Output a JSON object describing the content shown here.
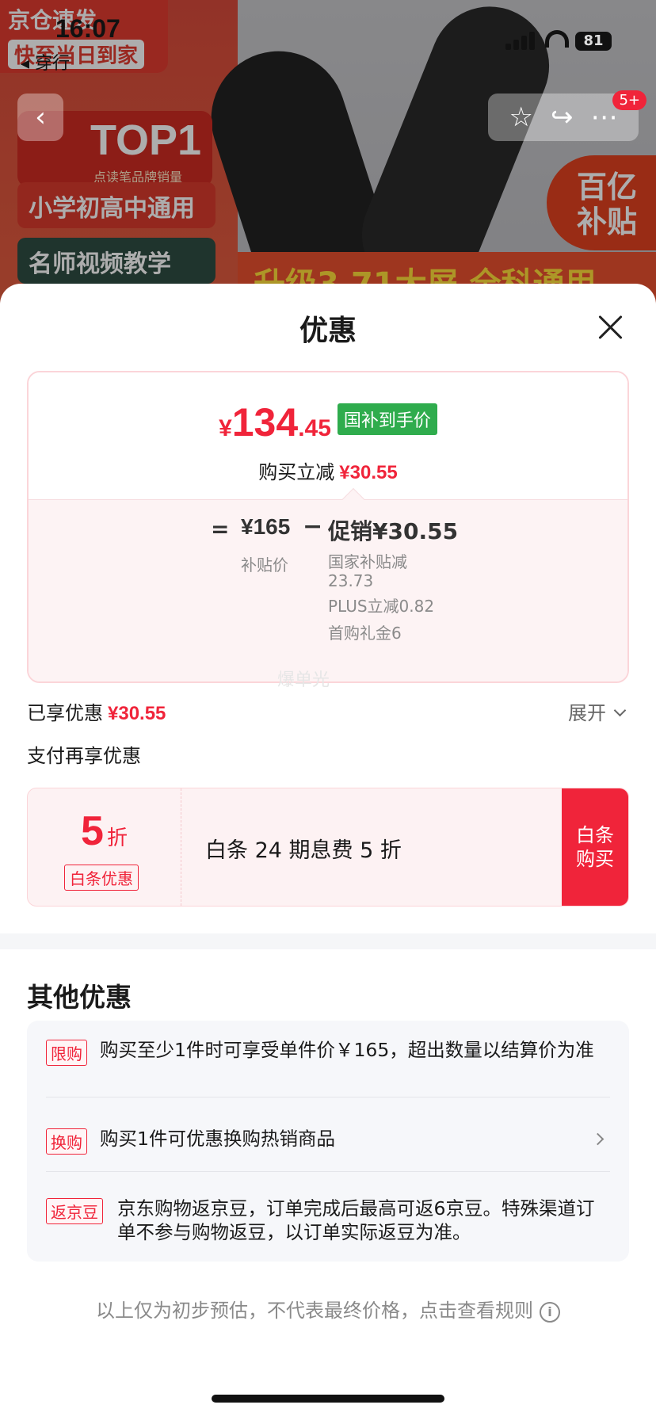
{
  "status_bar": {
    "time": "16:07",
    "back_app": "◂ 穿行",
    "battery": "81"
  },
  "background": {
    "promo_line1": "京仓速发",
    "promo_line2": "快至当日到家",
    "top1_title": "TOP1",
    "top1_subtitle": "点读笔品牌销量",
    "pill1": "小学初高中通用",
    "pill2": "名师视频教学",
    "upgrade_text": "升级3.71大屏 全科通用",
    "subsidy_text": "百亿补贴",
    "cart_badge": "5+"
  },
  "sheet": {
    "title": "优惠",
    "price_card": {
      "currency": "¥",
      "price_int": "134",
      "price_dec": ".45",
      "price_tag": "国补到手价",
      "saving_label": "购买立减",
      "saving_amount": "¥30.55",
      "eq_sign": "=",
      "base_value": "¥165",
      "base_label": "补贴价",
      "minus_sign": "−",
      "promo_head": "促销¥30.55",
      "promo_items": [
        "国家补贴减",
        "23.73",
        "PLUS立减0.82",
        "首购礼金6"
      ]
    },
    "watermark": "爆单光",
    "enjoyed_label": "已享优惠",
    "enjoyed_amount": "¥30.55",
    "expand_label": "展开",
    "pay_section_title": "支付再享优惠",
    "pay_card": {
      "discount_num": "5",
      "discount_unit": "折",
      "tag": "白条优惠",
      "description": "白条 24 期息费 5 折",
      "button_line1": "白条",
      "button_line2": "购买"
    },
    "other_title": "其他优惠",
    "other_rows": [
      {
        "tag": "限购",
        "text": "购买至少1件时可享受单件价￥165，超出数量以结算价为准"
      },
      {
        "tag": "换购",
        "text": "购买1件可优惠换购热销商品"
      },
      {
        "tag": "返京豆",
        "text": "京东购物返京豆，订单完成后最高可返6京豆。特殊渠道订单不参与购物返豆，以订单实际返豆为准。"
      }
    ],
    "footer_note": "以上仅为初步预估，不代表最终价格，点击查看规则",
    "info_icon_glyph": "i"
  },
  "colors": {
    "accent_red": "#f0243a",
    "tag_green": "#2fac4d"
  }
}
